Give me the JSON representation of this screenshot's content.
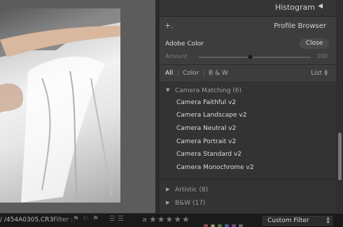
{
  "histogram": {
    "title": "Histogram"
  },
  "profile_browser": {
    "title": "Profile Browser",
    "current_profile": "Adobe Color",
    "close_label": "Close",
    "amount_label": "Amount",
    "amount_value": "100",
    "tabs": [
      "All",
      "Color",
      "B & W"
    ],
    "view_mode": "List",
    "groups": [
      {
        "name": "Camera Matching (6)",
        "expanded": true,
        "items": [
          "Camera Faithful v2",
          "Camera Landscape v2",
          "Camera Neutral v2",
          "Camera Portrait v2",
          "Camera Standard v2",
          "Camera Monochrome v2"
        ]
      },
      {
        "name": "Artistic (8)",
        "expanded": false
      },
      {
        "name": "B&W (17)",
        "expanded": false
      }
    ]
  },
  "filmstrip": {
    "filename": "/ /454A0305.CR3",
    "filter_label": "Filter :",
    "rating_op": "≥",
    "custom_filter": "Custom Filter",
    "swatch_colors": [
      "#b33a3a",
      "#b8a53a",
      "#3a8a3a",
      "#3a62b5",
      "#7a3ab0",
      "#6a6a6a"
    ]
  }
}
